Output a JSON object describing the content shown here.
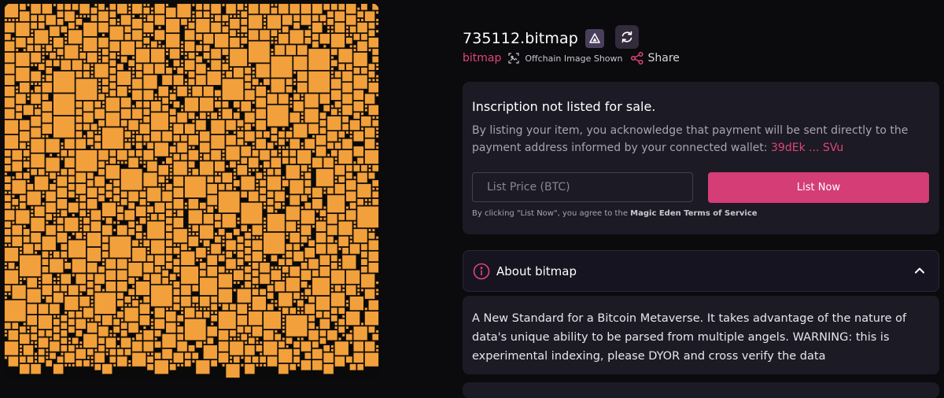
{
  "artwork": {
    "kind": "bitmap-block-visualization",
    "fill_color": "#f2a03b",
    "stroke_color": "#1a1208",
    "background": "#0a0a0a"
  },
  "inscription": {
    "title": "735112.bitmap",
    "badge_icon": "magic-eden-triangle-icon",
    "refresh_icon": "refresh-icon"
  },
  "meta": {
    "collection_link": "bitmap",
    "offchain_label": "Offchain Image Shown",
    "share_label": "Share"
  },
  "listing": {
    "status_title": "Inscription not listed for sale.",
    "description": "By listing your item, you acknowledge that payment will be sent directly to the payment address informed by your connected wallet: ",
    "wallet_address": "39dEk ... SVu",
    "price_placeholder": "List Price (BTC)",
    "list_button": "List Now",
    "terms_prefix": "By clicking \"List Now\", you agree to the ",
    "terms_link": "Magic Eden Terms of Service"
  },
  "about": {
    "header": "About bitmap",
    "expanded": true,
    "text": "A New Standard for a Bitcoin Metaverse. It takes advantage of the nature of data's unique ability to be parsed from multiple angels. WARNING: this is experimental indexing, please DYOR and cross verify the data"
  },
  "colors": {
    "accent": "#e0457a",
    "button": "#d43d76",
    "card": "#1c1a24",
    "page_bg": "#0b0a0d"
  }
}
